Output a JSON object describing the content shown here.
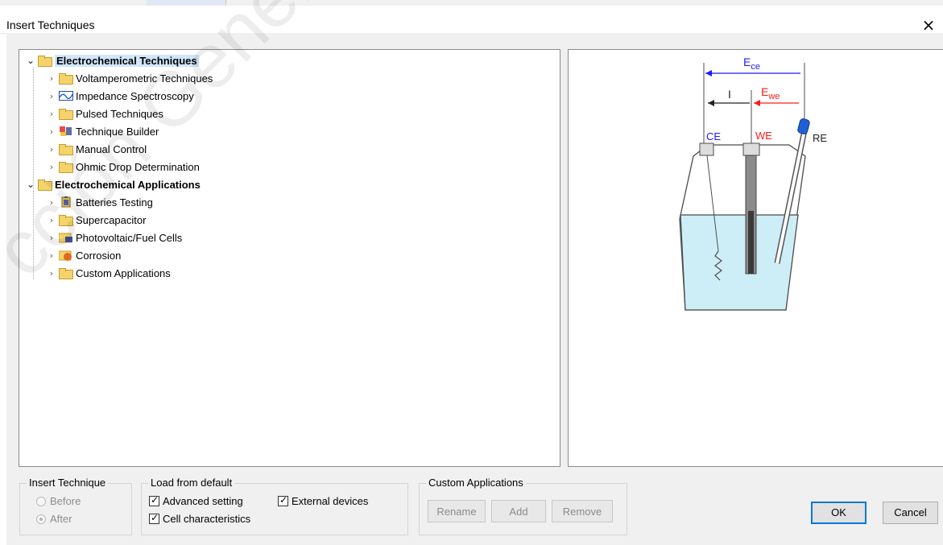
{
  "window": {
    "title": "Insert Techniques",
    "close_label": "×"
  },
  "watermark": "cción General de D",
  "tree": [
    {
      "label": "Electrochemical Techniques",
      "level": 0,
      "expanded": true,
      "bold": true,
      "selected": true,
      "icon": "folder-icon"
    },
    {
      "label": "Voltamperometric Techniques",
      "level": 1,
      "icon": "folder-icon"
    },
    {
      "label": "Impedance Spectroscopy",
      "level": 1,
      "icon": "impedance-icon"
    },
    {
      "label": "Pulsed Techniques",
      "level": 1,
      "icon": "folder-icon"
    },
    {
      "label": "Technique Builder",
      "level": 1,
      "icon": "builder-icon"
    },
    {
      "label": "Manual Control",
      "level": 1,
      "icon": "folder-icon"
    },
    {
      "label": "Ohmic Drop Determination",
      "level": 1,
      "icon": "folder-icon"
    },
    {
      "label": "Electrochemical Applications",
      "level": 0,
      "expanded": true,
      "bold": true,
      "icon": "folder-icon"
    },
    {
      "label": "Batteries Testing",
      "level": 1,
      "icon": "battery-icon"
    },
    {
      "label": "Supercapacitor",
      "level": 1,
      "icon": "folder-icon"
    },
    {
      "label": "Photovoltaic/Fuel Cells",
      "level": 1,
      "icon": "photovoltaic-icon"
    },
    {
      "label": "Corrosion",
      "level": 1,
      "icon": "corrosion-icon"
    },
    {
      "label": "Custom Applications",
      "level": 1,
      "icon": "folder-icon"
    }
  ],
  "diagram": {
    "ece_label": "E",
    "ece_sub": "ce",
    "ewe_label": "E",
    "ewe_sub": "we",
    "current_label": "I",
    "ce_label": "CE",
    "we_label": "WE",
    "re_label": "RE"
  },
  "insert_technique": {
    "title": "Insert Technique",
    "options": [
      "Before",
      "After"
    ],
    "selected": "After"
  },
  "load_default": {
    "title": "Load from default",
    "advanced": "Advanced setting",
    "external": "External devices",
    "cell": "Cell characteristics"
  },
  "custom_apps": {
    "title": "Custom Applications",
    "buttons": [
      "Rename",
      "Add",
      "Remove"
    ]
  },
  "actions": {
    "ok": "OK",
    "cancel": "Cancel"
  },
  "colors": {
    "blue": "#1d1cff",
    "red": "#ff1a1a",
    "liquid": "#cdeef7"
  }
}
